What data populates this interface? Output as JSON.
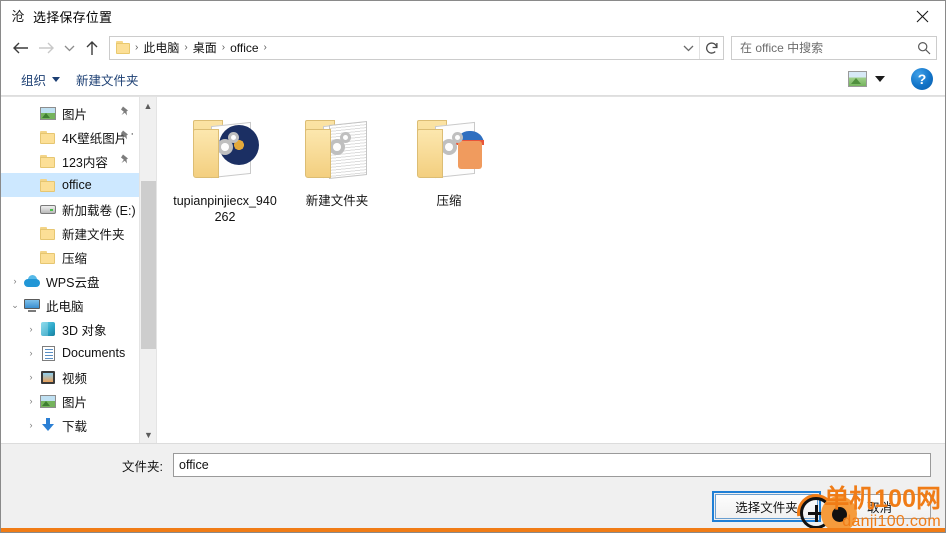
{
  "window": {
    "icon": "app-icon",
    "title": "选择保存位置",
    "close_label": "✕"
  },
  "nav": {
    "back_icon": "back-arrow-icon",
    "forward_icon": "forward-arrow-icon",
    "history_icon": "chevron-down-icon",
    "up_icon": "up-arrow-icon",
    "dropdown_icon": "chevron-down-icon",
    "refresh_icon": "refresh-icon",
    "breadcrumb": [
      "此电脑",
      "桌面",
      "office"
    ],
    "separator": "›"
  },
  "search": {
    "placeholder": "在 office 中搜索",
    "icon": "search-icon"
  },
  "toolbar": {
    "organize_label": "组织",
    "new_folder_label": "新建文件夹",
    "view_icon": "view-mode-icon",
    "view_caret_icon": "chevron-down-icon",
    "help_label": "?"
  },
  "sidebar": {
    "items": [
      {
        "label": "图片",
        "icon": "picture-icon",
        "indent": 1,
        "chevron": "",
        "pinned": true,
        "selected": false
      },
      {
        "label": "4K壁纸图片 ˙",
        "icon": "folder-icon",
        "indent": 1,
        "chevron": "",
        "pinned": true,
        "selected": false
      },
      {
        "label": "123内容",
        "icon": "folder-icon",
        "indent": 1,
        "chevron": "",
        "pinned": true,
        "selected": false
      },
      {
        "label": "office",
        "icon": "folder-icon",
        "indent": 1,
        "chevron": "",
        "pinned": false,
        "selected": true
      },
      {
        "label": "新加载卷 (E:)",
        "icon": "drive-icon",
        "indent": 1,
        "chevron": "",
        "pinned": false,
        "selected": false
      },
      {
        "label": "新建文件夹",
        "icon": "folder-icon",
        "indent": 1,
        "chevron": "",
        "pinned": false,
        "selected": false
      },
      {
        "label": "压缩",
        "icon": "folder-icon",
        "indent": 1,
        "chevron": "",
        "pinned": false,
        "selected": false
      },
      {
        "label": "WPS云盘",
        "icon": "cloud-icon",
        "indent": 0,
        "chevron": "›",
        "pinned": false,
        "selected": false
      },
      {
        "label": "此电脑",
        "icon": "this-pc-icon",
        "indent": 0,
        "chevron": "⌄",
        "pinned": false,
        "selected": false
      },
      {
        "label": "3D 对象",
        "icon": "3d-object-icon",
        "indent": 1,
        "chevron": "›",
        "pinned": false,
        "selected": false
      },
      {
        "label": "Documents",
        "icon": "documents-icon",
        "indent": 1,
        "chevron": "›",
        "pinned": false,
        "selected": false
      },
      {
        "label": "视频",
        "icon": "videos-icon",
        "indent": 1,
        "chevron": "›",
        "pinned": false,
        "selected": false
      },
      {
        "label": "图片",
        "icon": "picture-icon",
        "indent": 1,
        "chevron": "›",
        "pinned": false,
        "selected": false
      },
      {
        "label": "下载",
        "icon": "downloads-icon",
        "indent": 1,
        "chevron": "›",
        "pinned": false,
        "selected": false
      }
    ],
    "scroll_up_icon": "scroll-up-arrow-icon",
    "scroll_down_icon": "scroll-down-arrow-icon"
  },
  "files": [
    {
      "name": "tupianpinjiecx_940262",
      "kind": "folder",
      "overlay": "disc"
    },
    {
      "name": "新建文件夹",
      "kind": "folder",
      "overlay": "docs"
    },
    {
      "name": "压缩",
      "kind": "folder",
      "overlay": "zip"
    }
  ],
  "footer": {
    "folder_label": "文件夹:",
    "folder_value": "office",
    "select_button": "选择文件夹",
    "cancel_button": "取消"
  },
  "watermark": {
    "line1": "单机100网",
    "line2": "danji100.com"
  },
  "colors": {
    "selection": "#cde8ff",
    "accent": "#1f7fd6",
    "command_text": "#1c3f73",
    "watermark": "#f07c16",
    "folder": "#fcdf96"
  }
}
